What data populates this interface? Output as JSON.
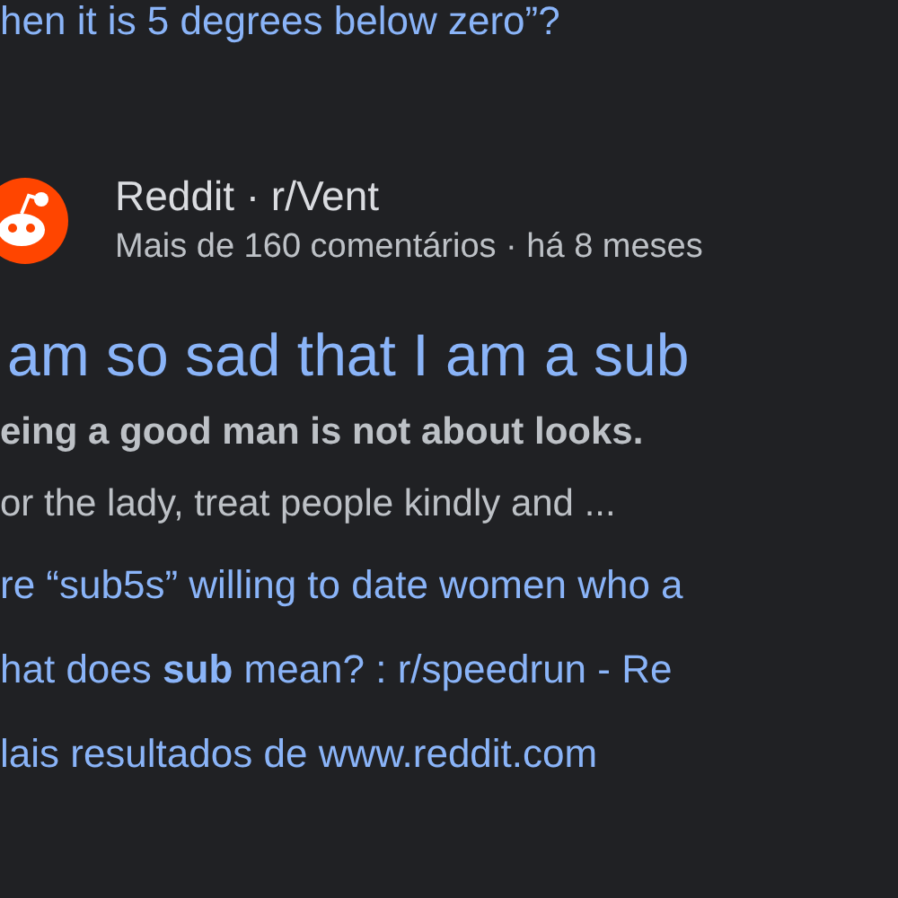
{
  "previous_result": {
    "title_tail": "hen it is 5 degrees below zero”?"
  },
  "result": {
    "source": {
      "site": "Reddit · r/Vent",
      "meta": "Mais de 160 comentários · há 8 meses"
    },
    "title": "am so sad that I am a sub",
    "snippet": [
      "eing a good man is not about looks.",
      "or the lady, treat people kindly and ..."
    ],
    "related_links": [
      "re “sub5s” willing to date women who a",
      "hat does **sub** mean? : r/speedrun - Re"
    ],
    "more_results": "lais resultados de www.reddit.com"
  }
}
